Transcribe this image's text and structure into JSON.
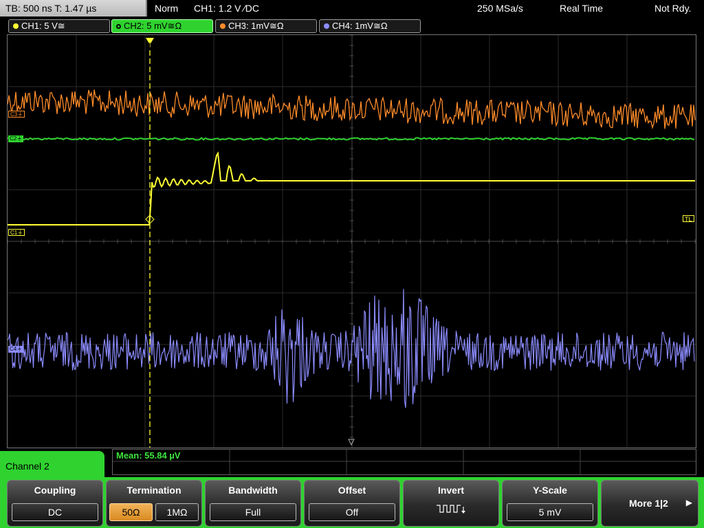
{
  "status": {
    "timebase": "TB: 500 ns   T: 1.47 µs",
    "trigger_mode": "Norm",
    "trigger_info": "CH1: 1.2 V ⁄DC",
    "sample_rate": "250 MSa/s",
    "acquisition": "Real Time",
    "trigger_status": "Not Rdy."
  },
  "channels": [
    {
      "label": "CH1: 5 V≅",
      "color": "#ffff33"
    },
    {
      "label": "CH2: 5 mV≅Ω",
      "color": "#2fd22f"
    },
    {
      "label": "CH3: 1mV≅Ω",
      "color": "#ff8c2a"
    },
    {
      "label": "CH4: 1mV≅Ω",
      "color": "#8c8cff"
    }
  ],
  "markers": {
    "c3": "C3⏚",
    "c2": "C2⏚",
    "c1": "C1⏚",
    "c4": "C4⏚",
    "trigger_level": "TL",
    "trigger_position": "T"
  },
  "measurement": "Mean: 55.84 µV",
  "menu": {
    "channel_title": "Channel 2",
    "coupling": {
      "title": "Coupling",
      "value": "DC"
    },
    "termination": {
      "title": "Termination",
      "options": [
        "50Ω",
        "1MΩ"
      ],
      "selected": "50Ω"
    },
    "bandwidth": {
      "title": "Bandwidth",
      "value": "Full"
    },
    "offset": {
      "title": "Offset",
      "value": "Off"
    },
    "invert": {
      "title": "Invert"
    },
    "yscale": {
      "title": "Y-Scale",
      "value": "5 mV"
    },
    "more": {
      "label": "More 1|2"
    }
  }
}
